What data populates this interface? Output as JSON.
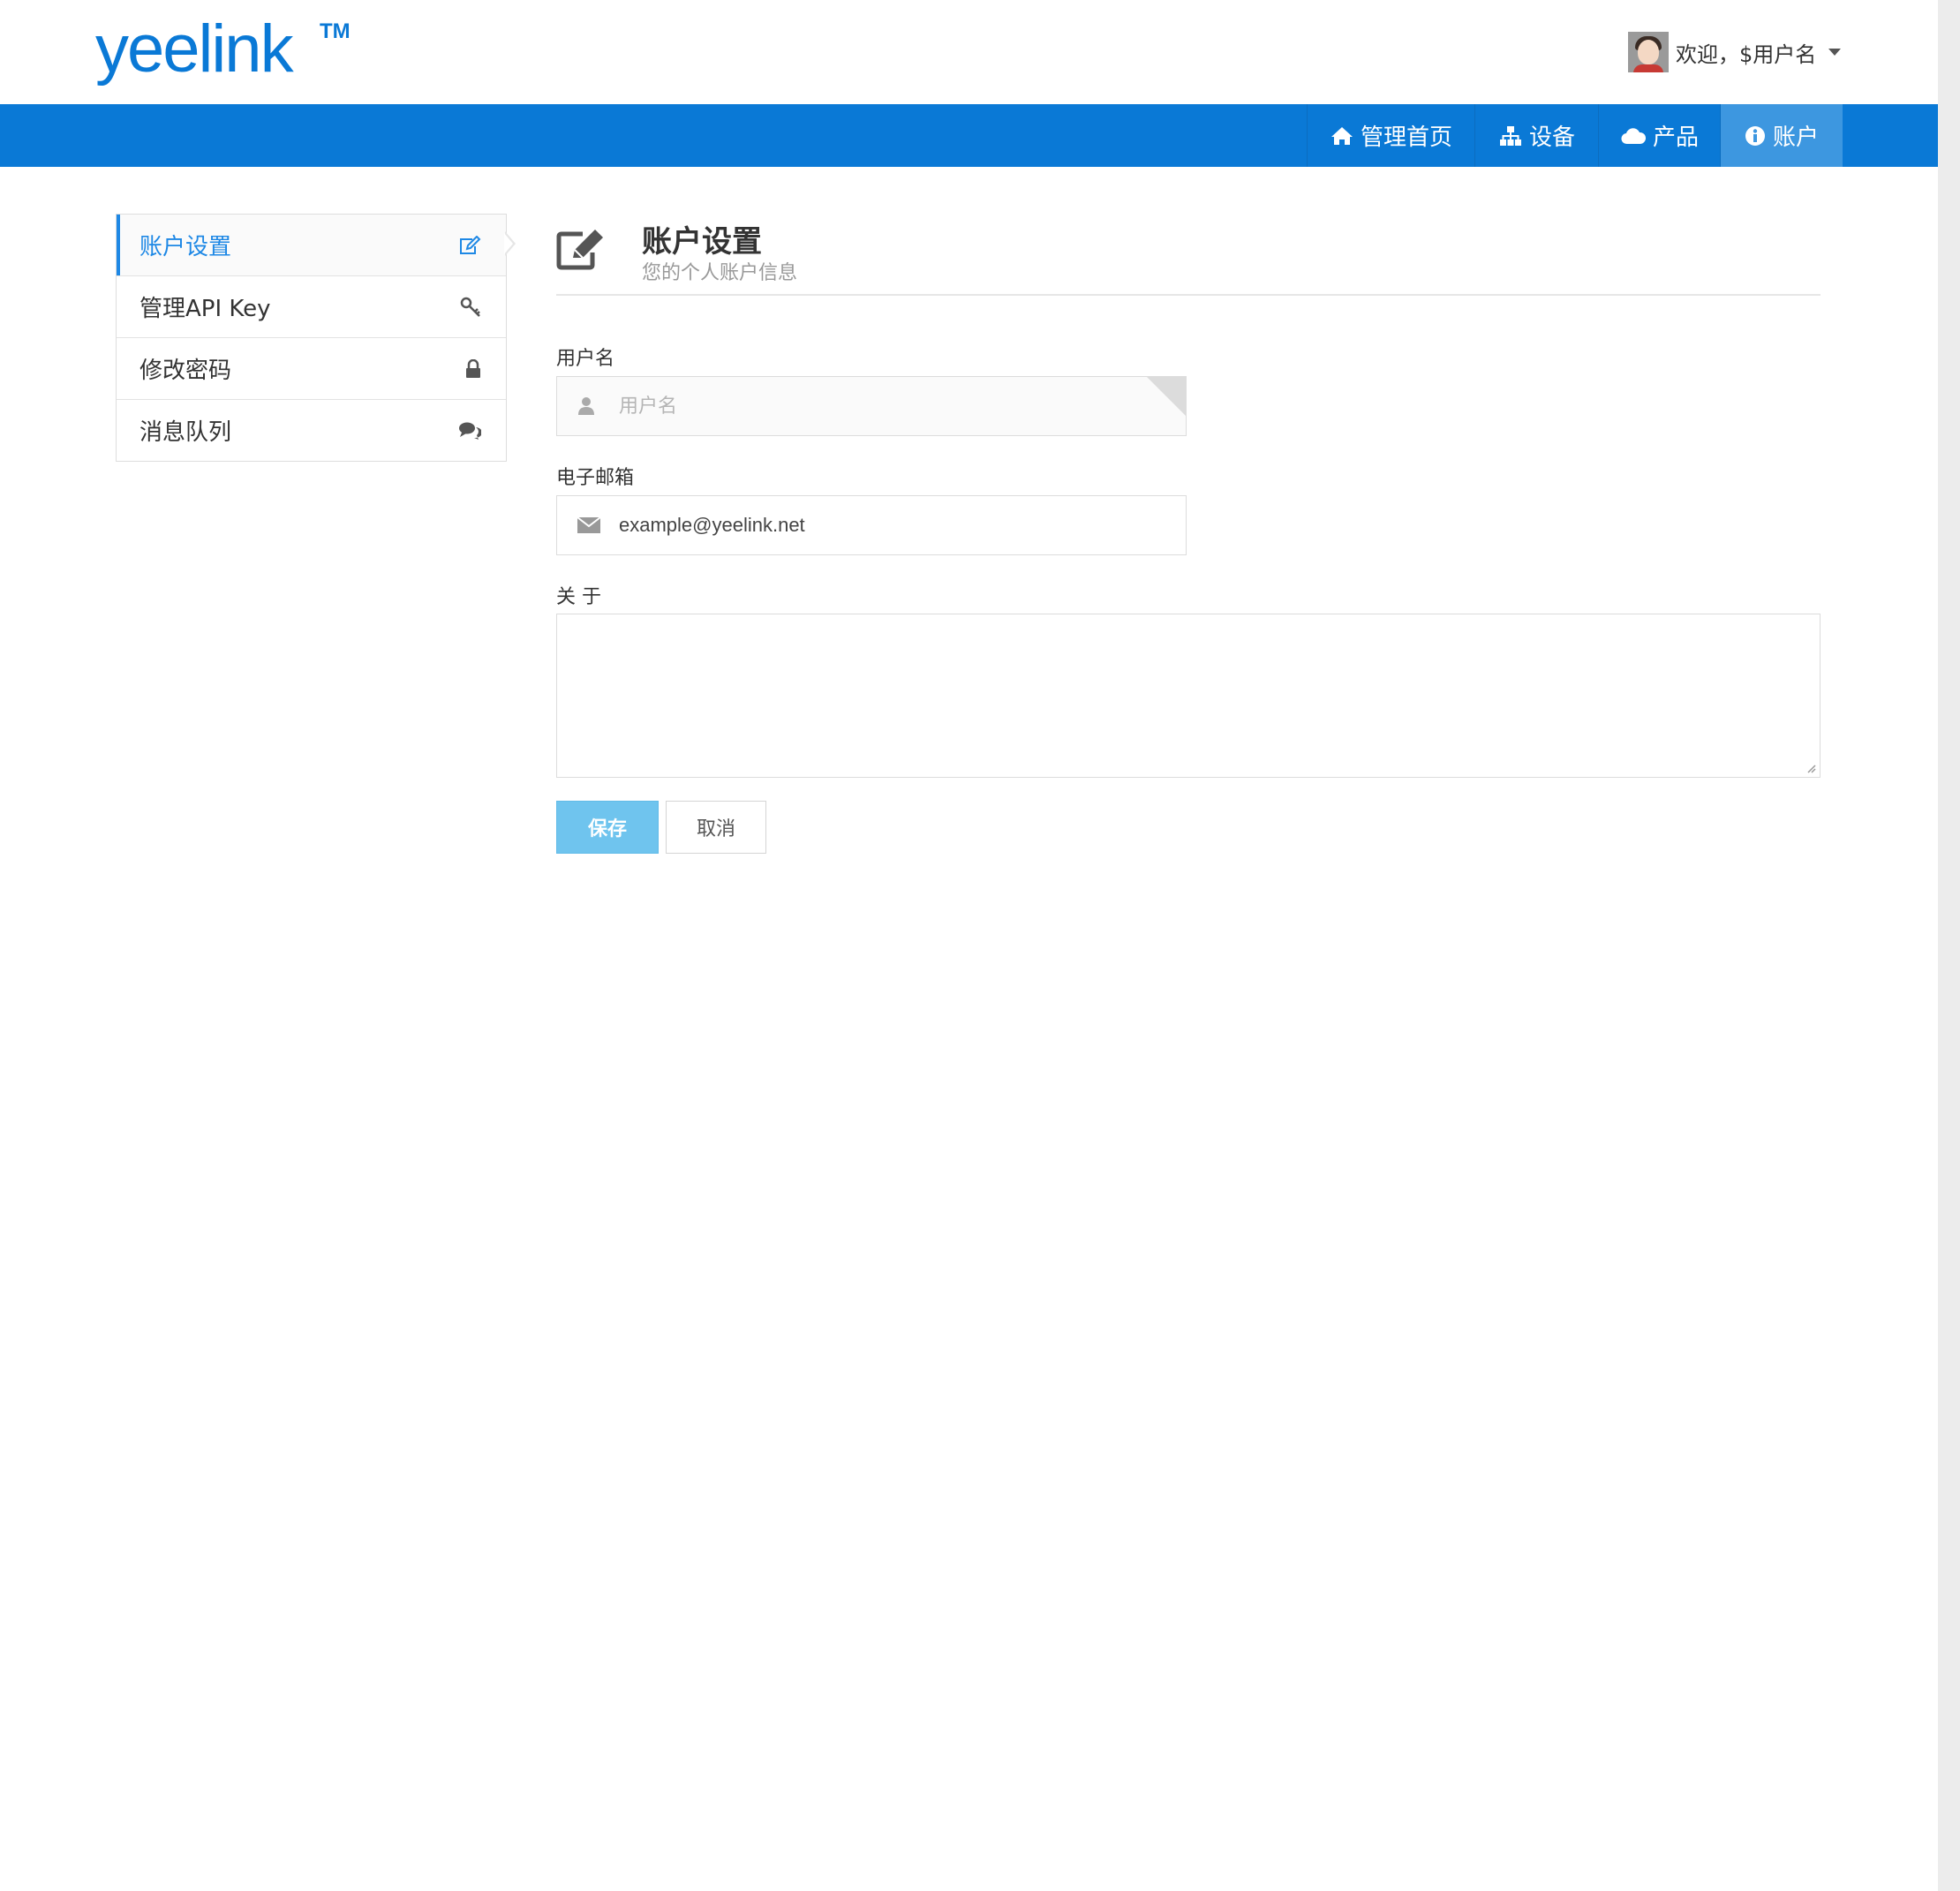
{
  "header": {
    "logo_text": "yeelink",
    "logo_tm": "TM",
    "welcome_text": "欢迎，$用户名"
  },
  "nav": {
    "items": [
      {
        "label": "管理首页",
        "icon": "home-icon"
      },
      {
        "label": "设备",
        "icon": "sitemap-icon"
      },
      {
        "label": "产品",
        "icon": "cloud-icon"
      },
      {
        "label": "账户",
        "icon": "info-circle-icon",
        "active": true
      }
    ]
  },
  "sidebar": {
    "items": [
      {
        "label": "账户设置",
        "icon": "edit-icon",
        "active": true
      },
      {
        "label": "管理API Key",
        "icon": "key-icon"
      },
      {
        "label": "修改密码",
        "icon": "lock-icon"
      },
      {
        "label": "消息队列",
        "icon": "comments-icon"
      }
    ]
  },
  "page": {
    "title": "账户设置",
    "subtitle": "您的个人账户信息"
  },
  "form": {
    "username_label": "用户名",
    "username_placeholder": "用户名",
    "email_label": "电子邮箱",
    "email_value": "example@yeelink.net",
    "about_label": "关 于",
    "save_label": "保存",
    "cancel_label": "取消"
  },
  "colors": {
    "brand": "#0a79d6",
    "nav_active": "#3d97e0",
    "accent": "#1e88e5",
    "save_button": "#6fc4ee"
  }
}
